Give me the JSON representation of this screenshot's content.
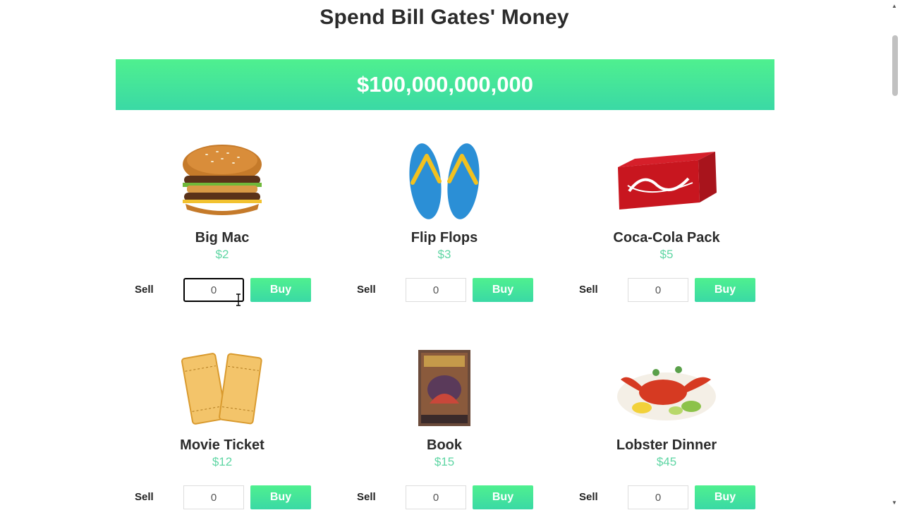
{
  "header": {
    "title": "Spend Bill Gates' Money"
  },
  "money": {
    "amount": "$100,000,000,000"
  },
  "items": [
    {
      "name": "Big Mac",
      "price": "$2",
      "sell_label": "Sell",
      "buy_label": "Buy",
      "quantity": "0",
      "image": "big-mac-image"
    },
    {
      "name": "Flip Flops",
      "price": "$3",
      "sell_label": "Sell",
      "buy_label": "Buy",
      "quantity": "0",
      "image": "flip-flops-image"
    },
    {
      "name": "Coca-Cola Pack",
      "price": "$5",
      "sell_label": "Sell",
      "buy_label": "Buy",
      "quantity": "0",
      "image": "coca-cola-pack-image"
    },
    {
      "name": "Movie Ticket",
      "price": "$12",
      "sell_label": "Sell",
      "buy_label": "Buy",
      "quantity": "0",
      "image": "movie-ticket-image"
    },
    {
      "name": "Book",
      "price": "$15",
      "sell_label": "Sell",
      "buy_label": "Buy",
      "quantity": "0",
      "image": "book-image"
    },
    {
      "name": "Lobster Dinner",
      "price": "$45",
      "sell_label": "Sell",
      "buy_label": "Buy",
      "quantity": "0",
      "image": "lobster-dinner-image"
    }
  ],
  "colors": {
    "accent": "#4ff08f",
    "accent_end": "#3ad9a5",
    "price": "#5fd6a4",
    "title": "#2b2b2b"
  }
}
